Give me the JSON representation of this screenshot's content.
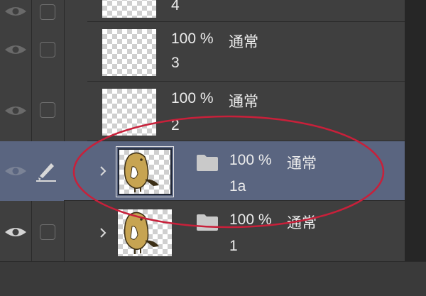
{
  "layers": [
    {
      "name": "4",
      "blend": "",
      "opacity": "",
      "type": "raster",
      "eye": false,
      "status": "checkbox",
      "selected": false,
      "has_chevron": false,
      "thumb": "empty"
    },
    {
      "name": "3",
      "blend": "通常",
      "opacity": "100 %",
      "type": "raster",
      "eye": true,
      "status": "checkbox",
      "selected": false,
      "has_chevron": false,
      "thumb": "empty"
    },
    {
      "name": "2",
      "blend": "通常",
      "opacity": "100 %",
      "type": "raster",
      "eye": true,
      "status": "checkbox",
      "selected": false,
      "has_chevron": false,
      "thumb": "empty"
    },
    {
      "name": "1a",
      "blend": "通常",
      "opacity": "100 %",
      "type": "folder",
      "eye": true,
      "status": "brush",
      "selected": true,
      "has_chevron": true,
      "thumb": "bird"
    },
    {
      "name": "1",
      "blend": "通常",
      "opacity": "100 %",
      "type": "folder",
      "eye": true,
      "status": "checkbox",
      "selected": false,
      "has_chevron": true,
      "thumb": "bird"
    }
  ],
  "colors": {
    "panel": "#3f3f3f",
    "selected_row": "#5a6580",
    "annotation": "#c8203a",
    "bird": "#c7a452"
  },
  "icons": {
    "visibility": "eye-icon",
    "lock": "checkbox-icon",
    "edit": "brush-icon",
    "expand": "chevron-right-icon",
    "folder": "folder-icon"
  }
}
